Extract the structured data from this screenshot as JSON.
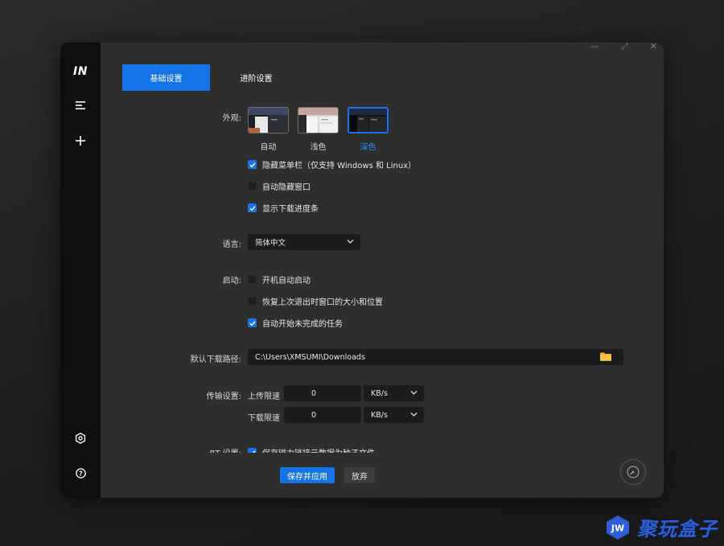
{
  "app": {
    "logo_text": "IN"
  },
  "tabs": [
    {
      "label": "基础设置",
      "active": true
    },
    {
      "label": "进阶设置",
      "active": false
    }
  ],
  "appearance": {
    "label": "外观:",
    "themes": [
      {
        "name": "自动",
        "selected": false
      },
      {
        "name": "浅色",
        "selected": false
      },
      {
        "name": "深色",
        "selected": true
      }
    ],
    "options": [
      {
        "label": "隐藏菜单栏（仅支持 Windows 和 Linux）",
        "checked": true
      },
      {
        "label": "自动隐藏窗口",
        "checked": false
      },
      {
        "label": "显示下载进度条",
        "checked": true
      }
    ]
  },
  "language": {
    "label": "语言:",
    "value": "简体中文"
  },
  "startup": {
    "label": "启动:",
    "options": [
      {
        "label": "开机自动启动",
        "checked": false
      },
      {
        "label": "恢复上次退出时窗口的大小和位置",
        "checked": false
      },
      {
        "label": "自动开始未完成的任务",
        "checked": true
      }
    ]
  },
  "download_path": {
    "label": "默认下载路径:",
    "value": "C:\\Users\\XMSUMI\\Downloads"
  },
  "transfer": {
    "label": "传输设置:",
    "upload_label": "上传限速",
    "upload_value": "0",
    "upload_unit": "KB/s",
    "download_label": "下载限速",
    "download_value": "0",
    "download_unit": "KB/s"
  },
  "bt": {
    "label": "BT 设置:",
    "option": {
      "label": "保存磁力链接元数据为种子文件",
      "checked": true
    }
  },
  "actions": {
    "save_label": "保存并应用",
    "discard_label": "放弃"
  },
  "watermark": {
    "badge_text": "JW",
    "text": "聚玩盒子"
  },
  "colors": {
    "accent": "#1473e6",
    "sidebar": "#0f0f0f",
    "panel": "#2e2e2e",
    "watermark": "#2f5fd8"
  }
}
